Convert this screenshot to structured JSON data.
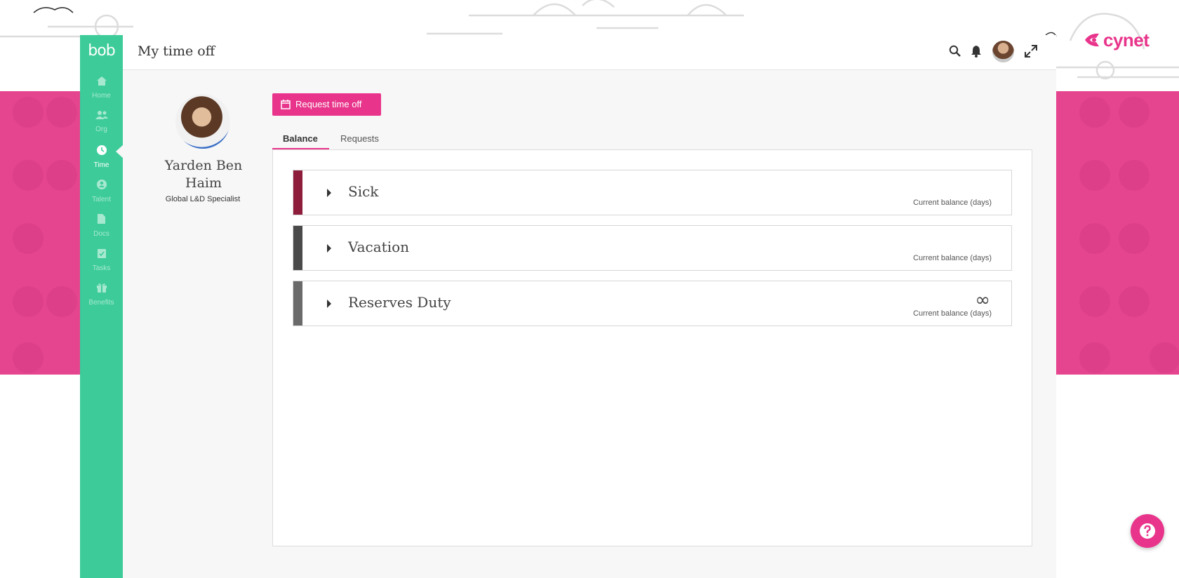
{
  "app": {
    "logo_text": "bob",
    "title": "My time off"
  },
  "brand": {
    "company_logo": "cynet",
    "accent_color": "#e8358b",
    "sidebar_color": "#3dcc99"
  },
  "sidebar": {
    "items": [
      {
        "label": "Home",
        "icon": "home-icon"
      },
      {
        "label": "Org",
        "icon": "people-icon"
      },
      {
        "label": "Time",
        "icon": "clock-icon",
        "active": true
      },
      {
        "label": "Talent",
        "icon": "talent-icon"
      },
      {
        "label": "Docs",
        "icon": "document-icon"
      },
      {
        "label": "Tasks",
        "icon": "tasks-icon"
      },
      {
        "label": "Benefits",
        "icon": "gift-icon"
      }
    ]
  },
  "header": {
    "icons": [
      "search-icon",
      "bell-icon",
      "avatar",
      "expand-icon"
    ]
  },
  "profile": {
    "name": "Yarden Ben Haim",
    "role": "Global L&D Specialist"
  },
  "actions": {
    "request_label": "Request time off"
  },
  "tabs": [
    {
      "label": "Balance",
      "active": true
    },
    {
      "label": "Requests",
      "active": false
    }
  ],
  "policies": [
    {
      "name": "Sick",
      "balance_label": "Current balance (days)",
      "color": "#8e1c3b",
      "balance_value": ""
    },
    {
      "name": "Vacation",
      "balance_label": "Current balance (days)",
      "color": "#4a4a4a",
      "balance_value": ""
    },
    {
      "name": "Reserves Duty",
      "balance_label": "Current balance (days)",
      "color": "#6a6a6a",
      "balance_value": "∞"
    }
  ]
}
